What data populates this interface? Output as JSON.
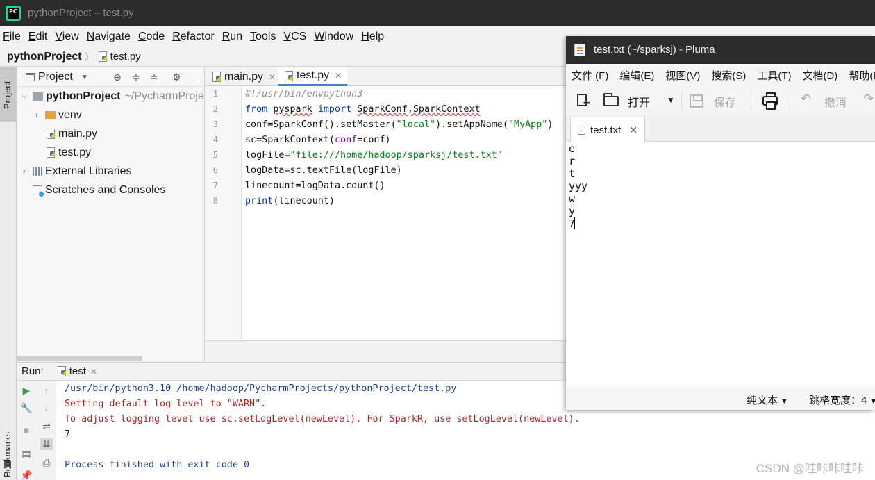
{
  "titlebar": {
    "title": "pythonProject – test.py",
    "logo_text": "PC"
  },
  "menu": [
    "File",
    "Edit",
    "View",
    "Navigate",
    "Code",
    "Refactor",
    "Run",
    "Tools",
    "VCS",
    "Window",
    "Help"
  ],
  "breadcrumb": {
    "project": "pythonProject",
    "file": "test.py"
  },
  "left_strip": {
    "project_tab": "Project",
    "bookmarks_tab": "Bookmarks"
  },
  "project_panel": {
    "header": "Project",
    "tree": [
      {
        "label": "pythonProject",
        "path": "~/PycharmProje"
      },
      {
        "label": "venv"
      },
      {
        "label": "main.py"
      },
      {
        "label": "test.py"
      },
      {
        "label": "External Libraries"
      },
      {
        "label": "Scratches and Consoles"
      }
    ]
  },
  "editor": {
    "tabs": [
      "main.py",
      "test.py"
    ],
    "active_tab": "test.py",
    "line_numbers": [
      "1",
      "2",
      "3",
      "4",
      "5",
      "6",
      "7",
      "8"
    ],
    "lines": [
      "#!/usr/bin/envpython3",
      "from pyspark import SparkConf,SparkContext",
      "conf=SparkConf().setMaster(\"local\").setAppName(\"MyApp\")",
      "sc=SparkContext(conf=conf)",
      "logFile=\"file:///home/hadoop/sparksj/test.txt\"",
      "logData=sc.textFile(logFile)",
      "linecount=logData.count()",
      "print(linecount)"
    ],
    "highlighted_line": 5
  },
  "run_panel": {
    "label": "Run:",
    "tab": "test",
    "output": [
      "/usr/bin/python3.10 /home/hadoop/PycharmProjects/pythonProject/test.py",
      "Setting default log level to \"WARN\".",
      "To adjust logging level use sc.setLogLevel(newLevel). For SparkR, use setLogLevel(newLevel).",
      "7",
      "",
      "Process finished with exit code 0"
    ]
  },
  "watermark": "CSDN @哇咔咔哇咔",
  "pluma": {
    "title": "test.txt (~/sparksj) - Pluma",
    "menu": [
      "文件 (F)",
      "编辑(E)",
      "视图(V)",
      "搜索(S)",
      "工具(T)",
      "文档(D)",
      "帮助(H)"
    ],
    "toolbar": {
      "open": "打开",
      "save": "保存",
      "undo": "撤消"
    },
    "tab": "test.txt",
    "text_lines": [
      "e",
      "r",
      "t",
      "yyy",
      "w",
      "y",
      "7"
    ],
    "status": {
      "syntax": "纯文本",
      "tab_width": "跳格宽度：4"
    }
  },
  "colors": {
    "keyword": "#0033b3",
    "string": "#067d17",
    "comment": "#8c8c8c",
    "console_path": "#1a3f96",
    "console_warn": "#b22222",
    "active_tab_underline": "#4083c9"
  },
  "icons": [
    "pycharm-logo-icon",
    "project-window-icon",
    "locate-icon",
    "expand-all-icon",
    "collapse-all-icon",
    "gear-icon",
    "minimize-icon",
    "folder-icon",
    "python-file-icon",
    "libraries-icon",
    "scratches-icon",
    "run-icon",
    "wrench-icon",
    "stop-icon",
    "up-arrow-icon",
    "down-arrow-icon",
    "soft-wrap-icon",
    "scroll-end-icon",
    "print-icon",
    "bookmark-icon",
    "new-document-icon",
    "open-folder-icon",
    "save-icon",
    "undo-icon",
    "redo-icon"
  ]
}
